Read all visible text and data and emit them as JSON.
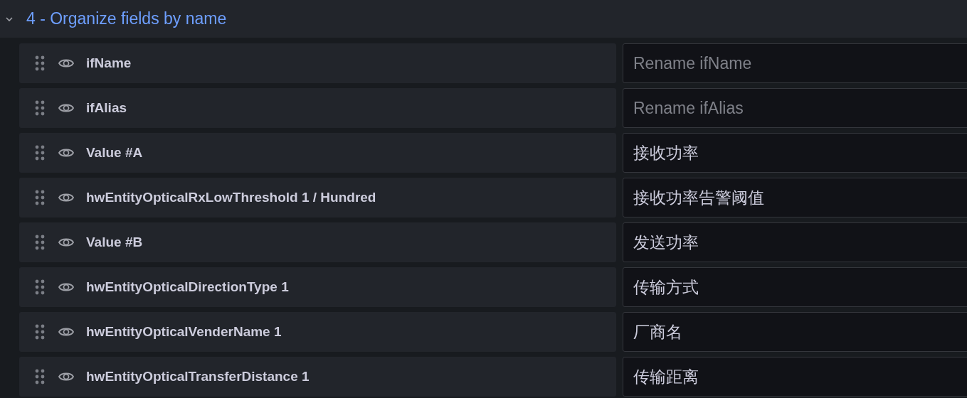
{
  "section": {
    "title": "4 - Organize fields by name",
    "expanded": true
  },
  "fields": [
    {
      "name": "ifName",
      "placeholder": "Rename ifName"
    },
    {
      "name": "ifAlias",
      "placeholder": "Rename ifAlias"
    },
    {
      "name": "Value #A",
      "value": "接收功率"
    },
    {
      "name": "hwEntityOpticalRxLowThreshold 1 / Hundred",
      "value": "接收功率告警阈值"
    },
    {
      "name": "Value #B",
      "value": "发送功率"
    },
    {
      "name": "hwEntityOpticalDirectionType 1",
      "value": "传输方式"
    },
    {
      "name": "hwEntityOpticalVenderName 1",
      "value": "厂商名"
    },
    {
      "name": "hwEntityOpticalTransferDistance 1",
      "value": "传输距离"
    }
  ]
}
